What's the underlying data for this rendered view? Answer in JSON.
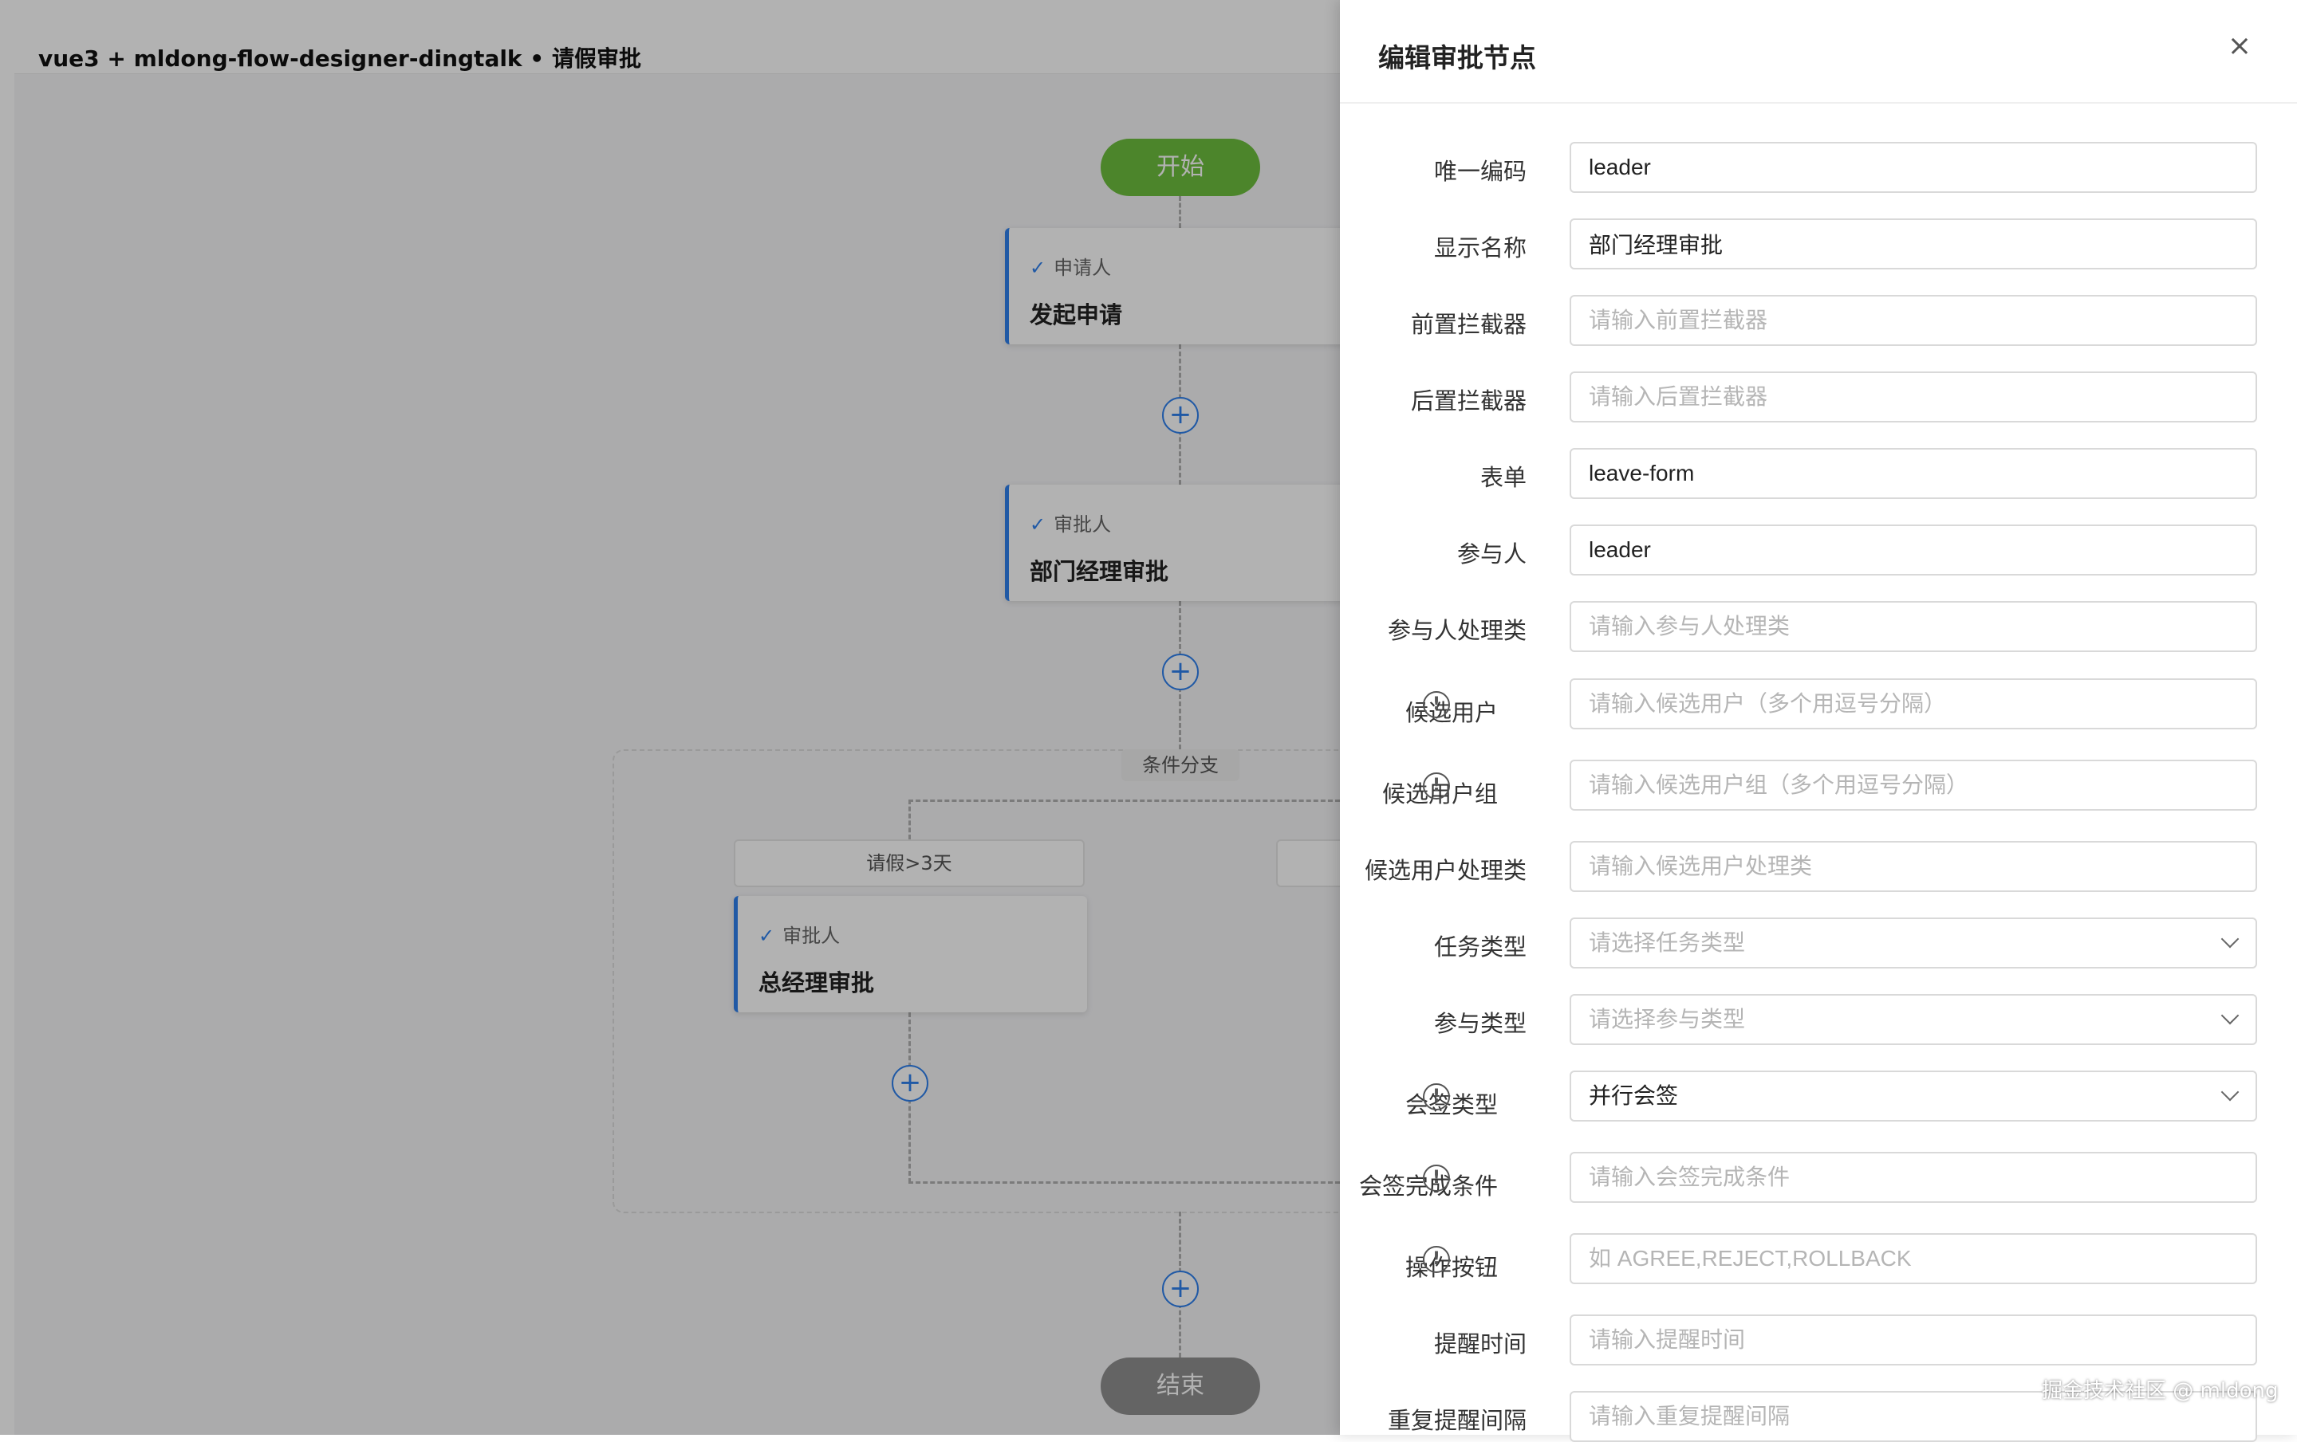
{
  "header": {
    "title": "vue3 + mldong-flow-designer-dingtalk • 请假审批"
  },
  "flow": {
    "start_label": "开始",
    "end_label": "结束",
    "nodes": [
      {
        "kind": "申请人",
        "name": "发起申请"
      },
      {
        "kind": "审批人",
        "name": "部门经理审批"
      },
      {
        "kind": "审批人",
        "name": "总经理审批"
      }
    ],
    "branch_label": "条件分支",
    "conditions": [
      "请假>3天"
    ],
    "check_icon": "check-icon",
    "add_icon": "plus-circle-icon",
    "accent_color": "#2f80ed",
    "start_color": "#6dbf3e",
    "end_color": "#909090"
  },
  "drawer": {
    "title": "编辑审批节点",
    "close_label": "×",
    "fields": [
      {
        "label": "唯一编码",
        "value": "leader",
        "placeholder": ""
      },
      {
        "label": "显示名称",
        "value": "部门经理审批",
        "placeholder": ""
      },
      {
        "label": "前置拦截器",
        "value": "",
        "placeholder": "请输入前置拦截器"
      },
      {
        "label": "后置拦截器",
        "value": "",
        "placeholder": "请输入后置拦截器"
      },
      {
        "label": "表单",
        "value": "leave-form",
        "placeholder": ""
      },
      {
        "label": "参与人",
        "value": "leader",
        "placeholder": ""
      },
      {
        "label": "参与人处理类",
        "value": "",
        "placeholder": "请输入参与人处理类"
      },
      {
        "label": "候选用户",
        "value": "",
        "placeholder": "请输入候选用户（多个用逗号分隔）",
        "info": true
      },
      {
        "label": "候选用户组",
        "value": "",
        "placeholder": "请输入候选用户组（多个用逗号分隔）",
        "info": true
      },
      {
        "label": "候选用户处理类",
        "value": "",
        "placeholder": "请输入候选用户处理类"
      },
      {
        "label": "任务类型",
        "value": "",
        "placeholder": "请选择任务类型",
        "select": true
      },
      {
        "label": "参与类型",
        "value": "",
        "placeholder": "请选择参与类型",
        "select": true
      },
      {
        "label": "会签类型",
        "value": "并行会签",
        "placeholder": "",
        "select": true,
        "info": true
      },
      {
        "label": "会签完成条件",
        "value": "",
        "placeholder": "请输入会签完成条件",
        "info": true
      },
      {
        "label": "操作按钮",
        "value": "",
        "placeholder": "如 AGREE,REJECT,ROLLBACK",
        "info": true
      },
      {
        "label": "提醒时间",
        "value": "",
        "placeholder": "请输入提醒时间"
      },
      {
        "label": "重复提醒间隔",
        "value": "",
        "placeholder": "请输入重复提醒间隔"
      }
    ],
    "info_icon": "info-circle-icon",
    "chevron_icon": "chevron-down-icon"
  },
  "watermark": "掘金技术社区 @ mldong"
}
